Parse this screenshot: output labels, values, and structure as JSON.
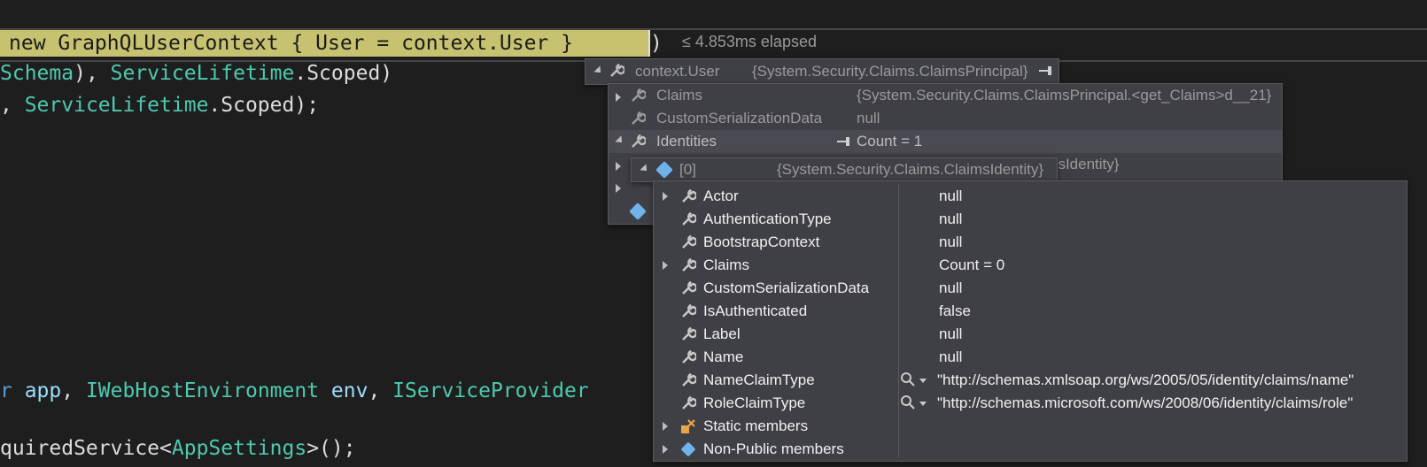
{
  "editor": {
    "elapsed": "≤ 4.853ms elapsed",
    "line_current": "new GraphQLUserContext { User = context.User }",
    "line_current_close": ")",
    "line2_a": "Schema",
    "line2_b": "), ",
    "line2_c": "ServiceLifetime",
    "line2_d": ".Scoped)",
    "line3_a": ", ",
    "line3_b": "ServiceLifetime",
    "line3_c": ".Scoped);",
    "line4_a": "r ",
    "line4_b": "app",
    "line4_c": ", ",
    "line4_d": "IWebHostEnvironment",
    "line4_e": " ",
    "line4_f": "env",
    "line4_g": ", ",
    "line4_h": "IServiceProvider",
    "line5_a": "quiredService<",
    "line5_b": "AppSettings",
    "line5_c": ">();"
  },
  "tip_root": {
    "name": "context.User",
    "value": "{System.Security.Claims.ClaimsPrincipal}"
  },
  "tip_principal": {
    "rows": [
      {
        "name": "Claims",
        "value": "{System.Security.Claims.ClaimsPrincipal.<get_Claims>d__21}"
      },
      {
        "name": "CustomSerializationData",
        "value": "null"
      },
      {
        "name": "Identities",
        "value": "Count = 1"
      }
    ],
    "partial_value": "nsIdentity}"
  },
  "tip_identities": {
    "name": "[0]",
    "value": "{System.Security.Claims.ClaimsIdentity}"
  },
  "tip_identity": {
    "rows": [
      {
        "name": "Actor",
        "value": "null"
      },
      {
        "name": "AuthenticationType",
        "value": "null"
      },
      {
        "name": "BootstrapContext",
        "value": "null"
      },
      {
        "name": "Claims",
        "value": "Count = 0"
      },
      {
        "name": "CustomSerializationData",
        "value": "null"
      },
      {
        "name": "IsAuthenticated",
        "value": "false"
      },
      {
        "name": "Label",
        "value": "null"
      },
      {
        "name": "Name",
        "value": "null"
      },
      {
        "name": "NameClaimType",
        "value": "\"http://schemas.xmlsoap.org/ws/2005/05/identity/claims/name\""
      },
      {
        "name": "RoleClaimType",
        "value": "\"http://schemas.microsoft.com/ws/2008/06/identity/claims/role\""
      },
      {
        "name": "Static members",
        "value": ""
      },
      {
        "name": "Non-Public members",
        "value": ""
      }
    ]
  }
}
